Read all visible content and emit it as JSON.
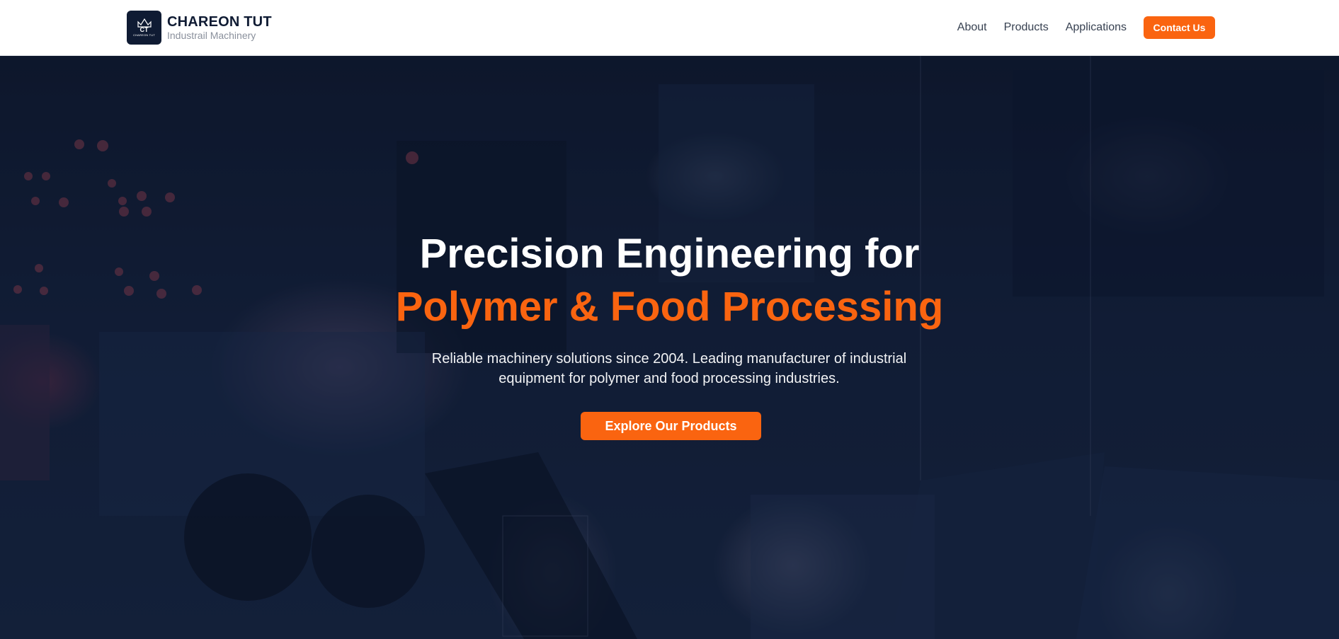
{
  "brand": {
    "logo_initials": "CT",
    "logo_small": "CHAREON TUT",
    "name": "CHAREON TUT",
    "tagline": "Industrail Machinery"
  },
  "nav": {
    "links": [
      "About",
      "Products",
      "Applications"
    ],
    "cta": "Contact Us"
  },
  "hero": {
    "title_line1": "Precision Engineering for",
    "title_line2": "Polymer & Food Processing",
    "subtitle": "Reliable machinery solutions since 2004. Leading manufacturer of industrial equipment for polymer and food processing industries.",
    "button": "Explore Our Products",
    "background_image": "factory-machinery-photo"
  },
  "colors": {
    "accent": "#fa6410",
    "navy": "#0f1b33",
    "hero_overlay": "#0c1428"
  }
}
